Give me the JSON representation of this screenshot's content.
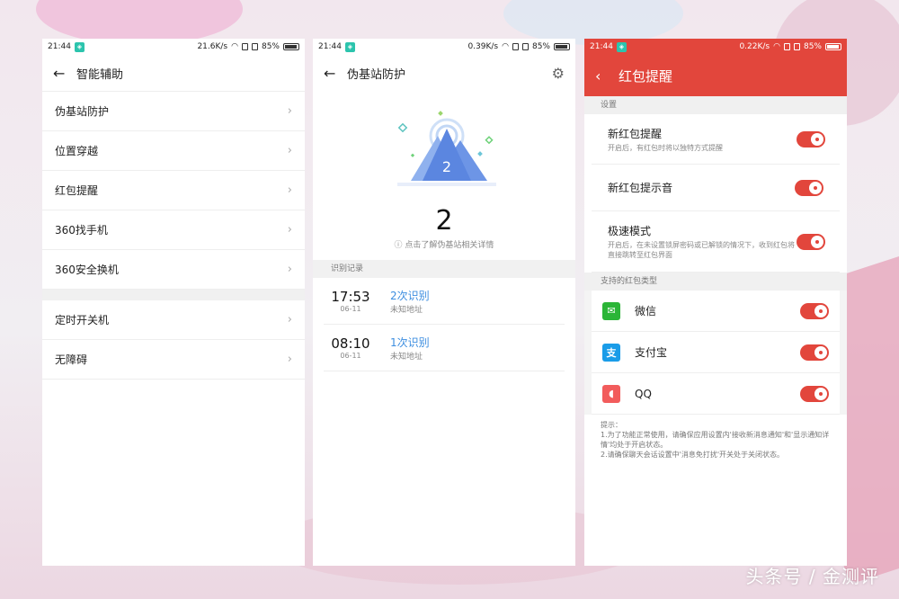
{
  "status_bars": [
    {
      "time": "21:44",
      "speed": "21.6K/s",
      "battery": "85%"
    },
    {
      "time": "21:44",
      "speed": "0.39K/s",
      "battery": "85%"
    },
    {
      "time": "21:44",
      "speed": "0.22K/s",
      "battery": "85%"
    }
  ],
  "screen1": {
    "title": "智能辅助",
    "items": [
      "伪基站防护",
      "位置穿越",
      "红包提醒",
      "360找手机",
      "360安全换机"
    ],
    "items2": [
      "定时开关机",
      "无障碍"
    ]
  },
  "screen2": {
    "title": "伪基站防护",
    "badge": "2",
    "count": "2",
    "hint": "点击了解伪基站相关详情",
    "section": "识别记录",
    "records": [
      {
        "time": "17:53",
        "date": "06-11",
        "count": "2次识别",
        "addr": "未知地址"
      },
      {
        "time": "08:10",
        "date": "06-11",
        "count": "1次识别",
        "addr": "未知地址"
      }
    ]
  },
  "screen3": {
    "title": "红包提醒",
    "section1": "设置",
    "options": [
      {
        "title": "新红包提醒",
        "desc": "开启后，有红包时将以独特方式提醒"
      },
      {
        "title": "新红包提示音",
        "desc": ""
      },
      {
        "title": "极速模式",
        "desc": "开启后，在未设置锁屏密码或已解锁的情况下，收到红包将直接跳转至红包界面"
      }
    ],
    "section2": "支持的红包类型",
    "apps": [
      {
        "name": "微信",
        "color": "#2bb537"
      },
      {
        "name": "支付宝",
        "color": "#1a9ce8"
      },
      {
        "name": "QQ",
        "color": "#f25c5c"
      }
    ],
    "note": "提示：\n1.为了功能正常使用，请确保应用设置内'接收新消息通知'和'显示通知详情'均处于开启状态。\n2.请确保聊天会话设置中'消息免打扰'开关处于关闭状态。"
  },
  "watermark": "头条号 / 金测评"
}
